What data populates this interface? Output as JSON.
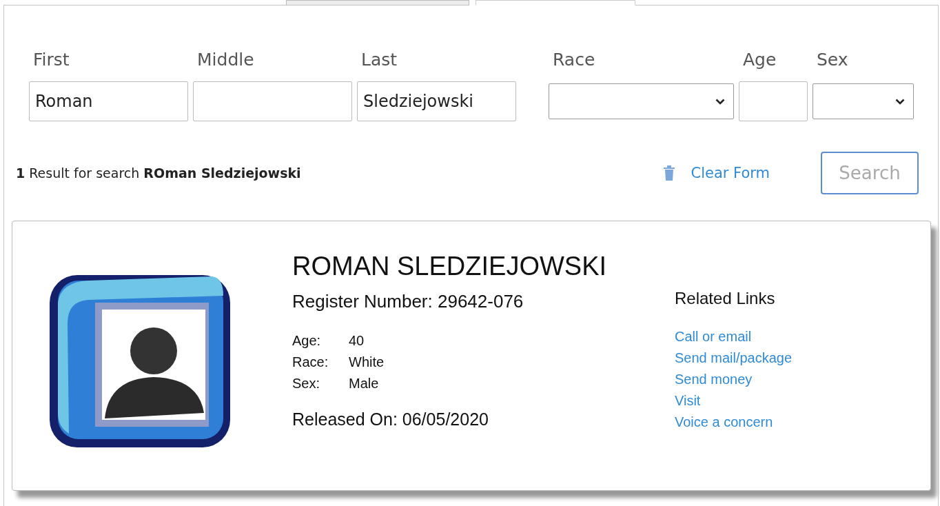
{
  "tabs": [
    {
      "selected": false
    },
    {
      "selected": true
    }
  ],
  "search_form": {
    "fields": [
      {
        "label": "First",
        "kind": "text",
        "value": "Roman"
      },
      {
        "label": "Middle",
        "kind": "text"
      },
      {
        "label": "Last",
        "kind": "text",
        "value": "Sledziejowski"
      },
      {
        "label": "Race",
        "kind": "select"
      },
      {
        "label": "Age",
        "kind": "text"
      },
      {
        "label": "Sex",
        "kind": "select"
      }
    ],
    "result_summary": "**1** Result for search **ROman Sledziejowski**",
    "clear_link": "Clear Form",
    "search_button": "Search"
  },
  "result": {
    "name": "ROMAN SLEDZIEJOWSKI",
    "register_number": "Register Number: 29642-076",
    "details": [
      {
        "label": "Age:",
        "value": "40"
      },
      {
        "label": "Race:",
        "value": "White"
      },
      {
        "label": "Sex:",
        "value": "Male"
      }
    ],
    "release": "Released On: 06/05/2020",
    "related_title": "Related Links",
    "links": [
      "Call or email",
      "Send mail/package",
      "Send money",
      "Visit",
      "Voice a concern"
    ]
  }
}
